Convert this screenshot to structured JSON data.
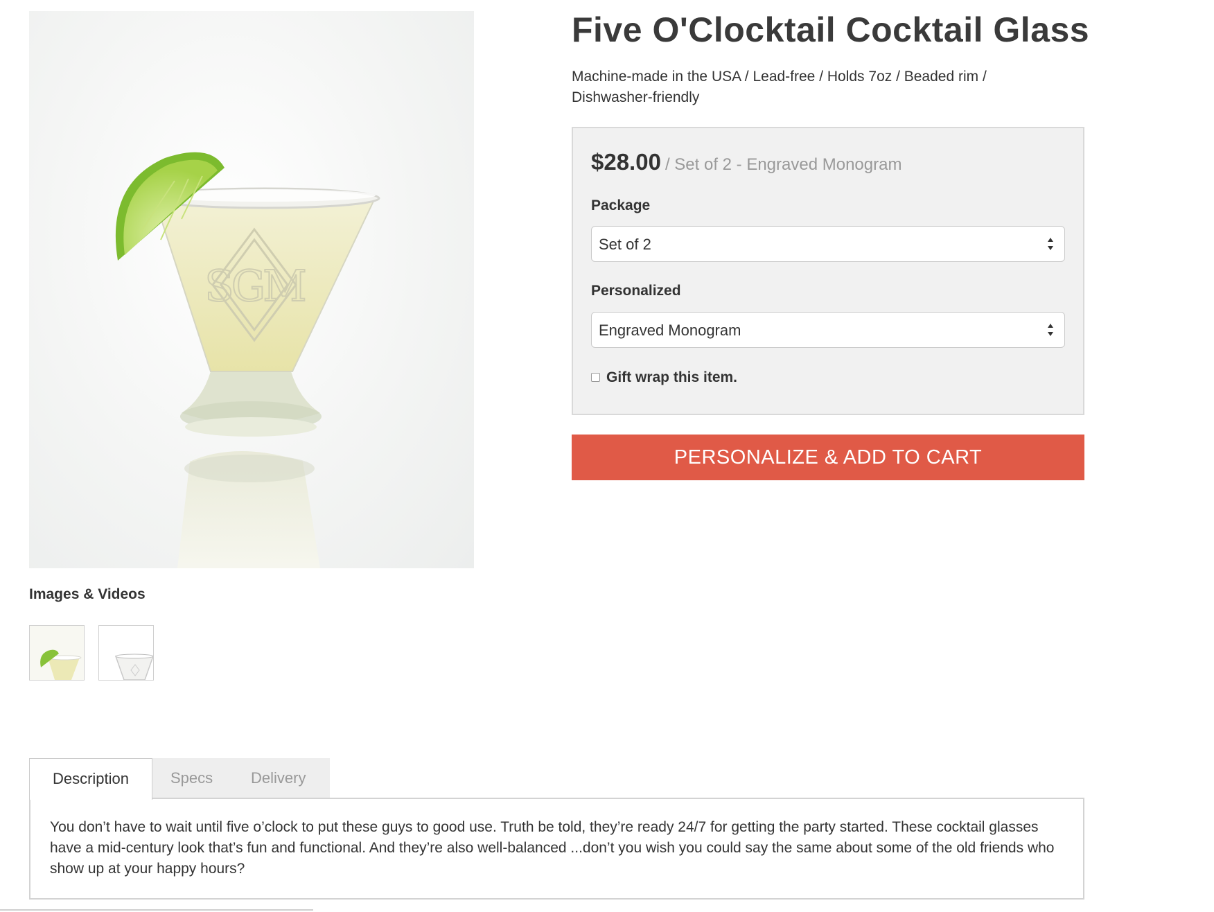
{
  "product": {
    "title": "Five O'Clocktail Cocktail Glass",
    "features": "Machine-made in the USA / Lead-free / Holds 7oz / Beaded rim / Dishwasher-friendly",
    "price": "$28.00",
    "price_detail": "/ Set of 2 - Engraved Monogram",
    "monogram_letters": "SGM"
  },
  "options": {
    "package_label": "Package",
    "package_value": "Set of 2",
    "personalized_label": "Personalized",
    "personalized_value": "Engraved Monogram",
    "gift_wrap_label": "Gift wrap this item.",
    "gift_wrap_checked": false
  },
  "cta": {
    "add_to_cart_label": "PERSONALIZE & ADD TO CART"
  },
  "media": {
    "heading": "Images & Videos",
    "thumbnails": [
      "lime-margarita-glass",
      "empty-cocktail-glass"
    ]
  },
  "tabs": {
    "items": [
      "Description",
      "Specs",
      "Delivery"
    ],
    "active": "Description",
    "description": "You don’t have to wait until five o’clock to put these guys to good use. Truth be told, they’re ready 24/7 for getting the party started. These cocktail glasses have a mid-century look that’s fun and functional. And they’re also well-balanced ...don’t you wish you could say the same about some of the old friends who show up at your happy hours?"
  },
  "colors": {
    "accent": "#e05a47",
    "panel_bg": "#f1f1f1",
    "muted_text": "#999999",
    "lime": "#8cc43c"
  }
}
